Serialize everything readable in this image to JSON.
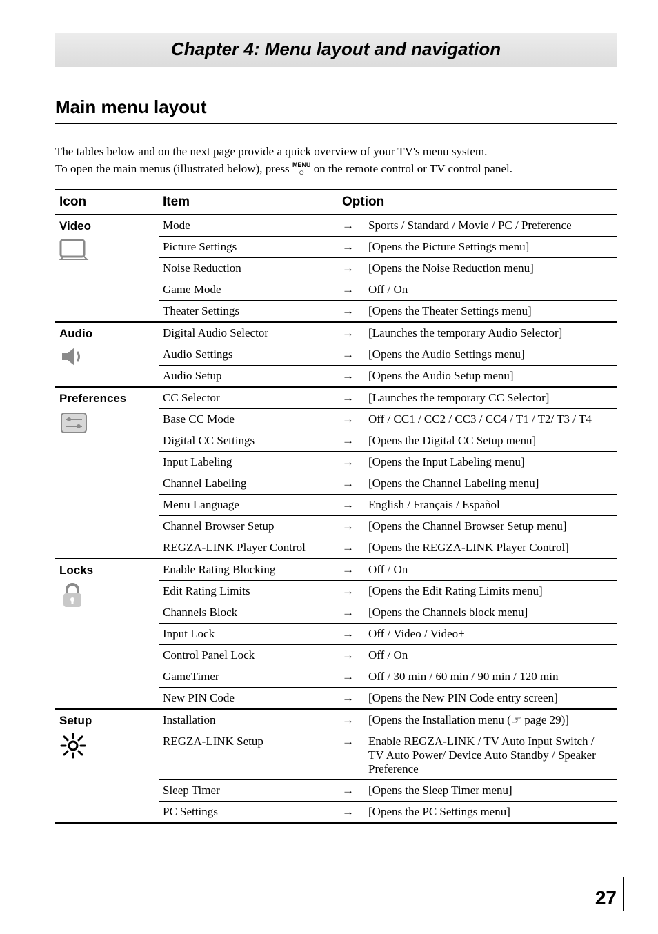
{
  "chapter_title": "Chapter 4: Menu layout and navigation",
  "section_title": "Main menu layout",
  "intro_line1": "The tables below and on the next page provide a quick overview of your TV's menu system.",
  "intro_line2_a": "To open the main menus (illustrated below), press ",
  "intro_menu_word": "MENU",
  "intro_line2_b": " on the remote control or TV control panel.",
  "columns": {
    "icon": "Icon",
    "item": "Item",
    "option": "Option"
  },
  "groups": [
    {
      "name": "Video",
      "icon": "video",
      "rows": [
        {
          "item": "Mode",
          "option": "Sports / Standard / Movie / PC / Preference"
        },
        {
          "item": "Picture Settings",
          "option": "[Opens the Picture Settings menu]"
        },
        {
          "item": "Noise Reduction",
          "option": "[Opens the Noise Reduction menu]"
        },
        {
          "item": "Game Mode",
          "option": "Off / On"
        },
        {
          "item": "Theater Settings",
          "option": "[Opens the Theater Settings menu]"
        }
      ]
    },
    {
      "name": "Audio",
      "icon": "audio",
      "rows": [
        {
          "item": "Digital Audio Selector",
          "option": "[Launches the temporary Audio Selector]"
        },
        {
          "item": "Audio Settings",
          "option": "[Opens the Audio Settings menu]"
        },
        {
          "item": "Audio Setup",
          "option": "[Opens the Audio Setup menu]"
        }
      ]
    },
    {
      "name": "Preferences",
      "icon": "preferences",
      "rows": [
        {
          "item": "CC Selector",
          "option": "[Launches the temporary CC Selector]"
        },
        {
          "item": "Base CC Mode",
          "option": "Off / CC1 / CC2 / CC3 / CC4 / T1 / T2/ T3 / T4"
        },
        {
          "item": "Digital CC Settings",
          "option": "[Opens the Digital CC Setup menu]"
        },
        {
          "item": "Input Labeling",
          "option": "[Opens the Input Labeling menu]"
        },
        {
          "item": "Channel Labeling",
          "option": "[Opens the Channel Labeling menu]"
        },
        {
          "item": "Menu Language",
          "option": "English / Français / Español"
        },
        {
          "item": "Channel Browser Setup",
          "option": "[Opens the Channel Browser Setup menu]"
        },
        {
          "item": "REGZA-LINK Player Control",
          "option": "[Opens the REGZA-LINK Player Control]"
        }
      ]
    },
    {
      "name": "Locks",
      "icon": "locks",
      "rows": [
        {
          "item": "Enable Rating Blocking",
          "option": "Off / On"
        },
        {
          "item": "Edit Rating Limits",
          "option": "[Opens the Edit Rating Limits menu]"
        },
        {
          "item": "Channels Block",
          "option": "[Opens the Channels block menu]"
        },
        {
          "item": "Input Lock",
          "option": "Off / Video / Video+"
        },
        {
          "item": "Control Panel Lock",
          "option": "Off / On"
        },
        {
          "item": "GameTimer",
          "option": "Off / 30 min / 60 min / 90 min / 120 min"
        },
        {
          "item": "New PIN Code",
          "option": "[Opens the New PIN Code entry screen]"
        }
      ]
    },
    {
      "name": "Setup",
      "icon": "setup",
      "rows": [
        {
          "item": "Installation",
          "option": "[Opens the Installation menu (☞ page 29)]"
        },
        {
          "item": "REGZA-LINK Setup",
          "option": "Enable REGZA-LINK / TV Auto Input Switch / TV Auto Power/ Device Auto Standby / Speaker Preference"
        },
        {
          "item": "Sleep Timer",
          "option": "[Opens the Sleep Timer menu]"
        },
        {
          "item": "PC Settings",
          "option": "[Opens the PC Settings menu]"
        }
      ]
    }
  ],
  "arrow": "→",
  "page_number": "27"
}
